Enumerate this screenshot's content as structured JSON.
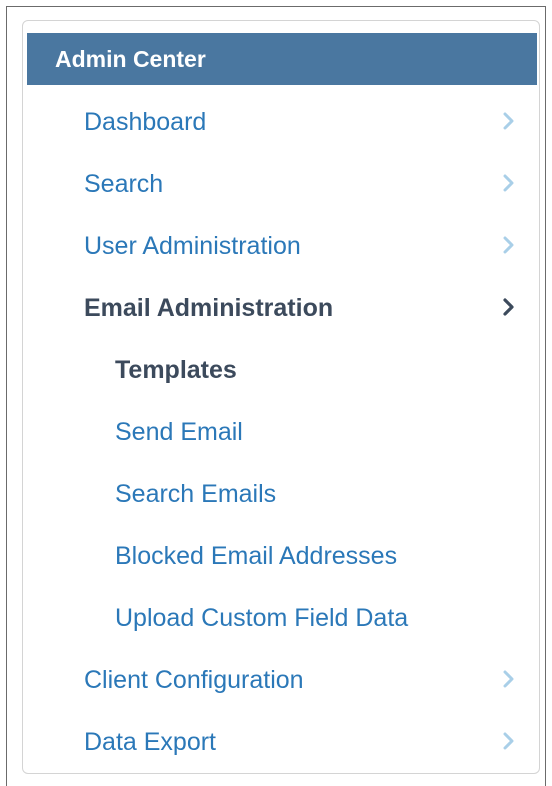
{
  "panel": {
    "title": "Admin Center"
  },
  "menu": {
    "items": [
      {
        "label": "Dashboard"
      },
      {
        "label": "Search"
      },
      {
        "label": "User Administration"
      },
      {
        "label": "Email Administration"
      },
      {
        "label": "Templates"
      },
      {
        "label": "Send Email"
      },
      {
        "label": "Search Emails"
      },
      {
        "label": "Blocked Email Addresses"
      },
      {
        "label": "Upload Custom Field Data"
      },
      {
        "label": "Client Configuration"
      },
      {
        "label": "Data Export"
      }
    ]
  },
  "colors": {
    "header_bg": "#4a77a0",
    "link": "#2b78b8",
    "active_text": "#3c4a5c",
    "chevron_inactive": "#a9cfe8",
    "chevron_active": "#3c4a5c"
  },
  "icons": {
    "chevron": "chevron-right-icon"
  }
}
